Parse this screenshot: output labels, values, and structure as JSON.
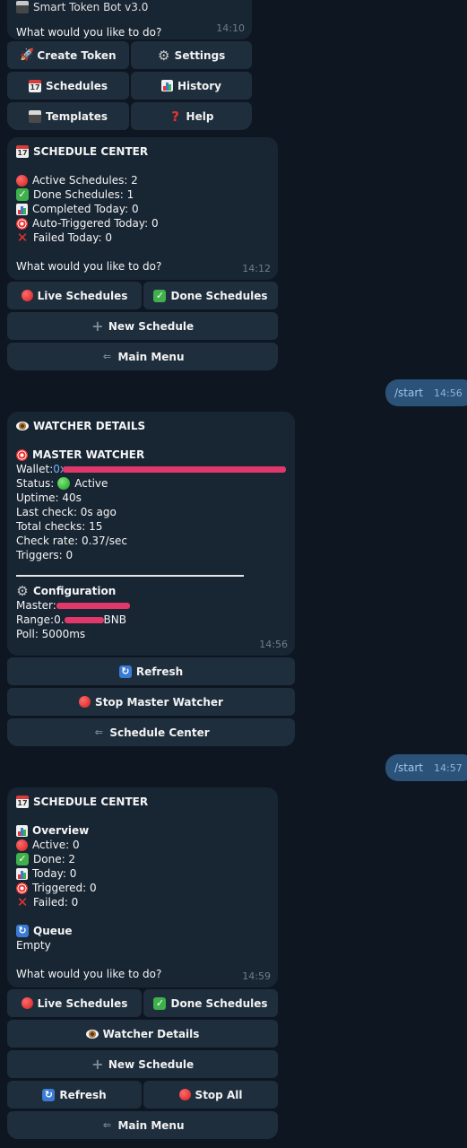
{
  "top_bubble": {
    "cut_title": "Smart Token Bot v3.0",
    "prompt": "What would you like to do?",
    "time": "14:10"
  },
  "main_menu_buttons": {
    "create_token": "Create Token",
    "settings": "Settings",
    "schedules": "Schedules",
    "history": "History",
    "templates": "Templates",
    "help": "Help"
  },
  "schedule_center_1": {
    "title": "SCHEDULE CENTER",
    "active": "Active Schedules: 2",
    "done": "Done Schedules: 1",
    "completed": "Completed Today: 0",
    "auto_triggered": "Auto-Triggered Today: 0",
    "failed": "Failed Today: 0",
    "prompt": "What would you like to do?",
    "time": "14:12",
    "buttons": {
      "live": "Live Schedules",
      "done": "Done Schedules",
      "new": "New Schedule",
      "main_menu": "Main Menu"
    }
  },
  "outgoing_1": {
    "text": "/start",
    "time": "14:56"
  },
  "watcher_details": {
    "title": "WATCHER DETAILS",
    "master_watcher": "MASTER WATCHER",
    "wallet_label": "Wallet: ",
    "wallet_value_visible": "0x",
    "status_label": "Status: ",
    "status_value": "Active",
    "uptime": "Uptime: 40s",
    "last_check": "Last check: 0s ago",
    "total_checks": "Total checks: 15",
    "check_rate": "Check rate: 0.37/sec",
    "triggers": "Triggers: 0",
    "configuration": "Configuration",
    "master_label": "Master: ",
    "range_label": "Range: ",
    "range_visible_start": "0.",
    "range_visible_end": "BNB",
    "poll": "Poll: 5000ms",
    "time": "14:56",
    "buttons": {
      "refresh": "Refresh",
      "stop_master": "Stop Master Watcher",
      "schedule_center": "Schedule Center"
    }
  },
  "outgoing_2": {
    "text": "/start",
    "time": "14:57"
  },
  "schedule_center_2": {
    "title": "SCHEDULE CENTER",
    "overview": "Overview",
    "active": "Active: 0",
    "done": "Done: 2",
    "today": "Today: 0",
    "triggered": "Triggered: 0",
    "failed": "Failed: 0",
    "queue": "Queue",
    "queue_value": "Empty",
    "prompt": "What would you like to do?",
    "time": "14:59",
    "buttons": {
      "live": "Live Schedules",
      "done": "Done Schedules",
      "watcher": "Watcher Details",
      "new": "New Schedule",
      "refresh": "Refresh",
      "stop_all": "Stop All",
      "main_menu": "Main Menu"
    }
  },
  "colors": {
    "background": "#0e1621",
    "incoming_bubble": "#182533",
    "outgoing_bubble": "#2b5278",
    "button": "#1f2e3d",
    "redaction": "#e0386a"
  }
}
